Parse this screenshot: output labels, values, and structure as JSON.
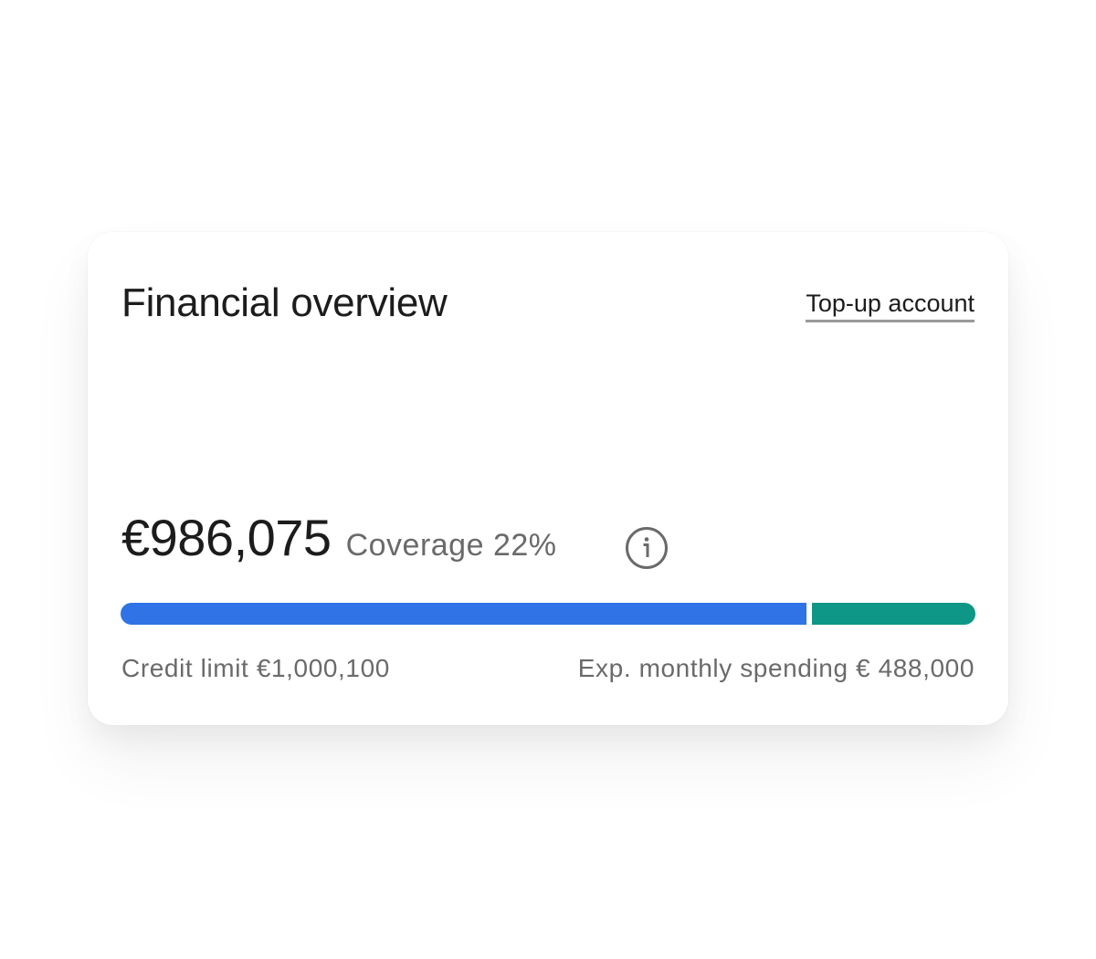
{
  "card": {
    "title": "Financial overview",
    "topup_label": "Top-up account",
    "balance": "€986,075",
    "coverage_label": "Coverage 22%",
    "info_icon": "info-circle-icon",
    "progress": {
      "credit_fraction": 0.808,
      "spending_fraction": 0.192
    },
    "credit_limit_label": "Credit limit €1,000,100",
    "monthly_spending_label": "Exp. monthly spending € 488,000"
  },
  "colors": {
    "credit_bar": "#2f73e6",
    "spending_bar": "#0e9786",
    "text_primary": "#1c1c1c",
    "text_secondary": "#6a6a6a"
  }
}
